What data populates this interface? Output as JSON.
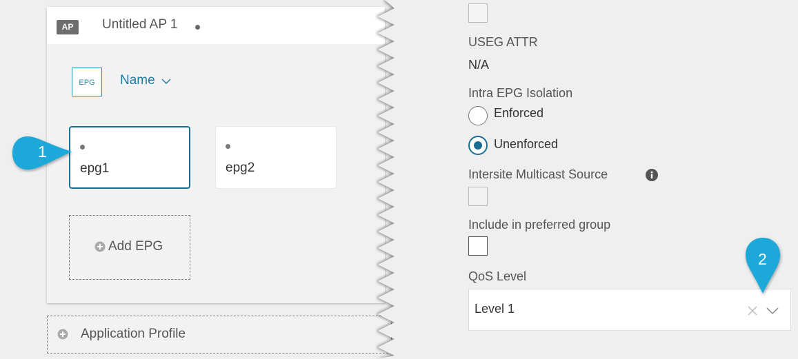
{
  "left_panel": {
    "ap": {
      "badge": "AP",
      "title": "Untitled AP 1"
    },
    "epg_header": {
      "icon_label": "EPG",
      "sort_label": "Name"
    },
    "epgs": [
      {
        "label": "epg1",
        "selected": true
      },
      {
        "label": "epg2",
        "selected": false
      }
    ],
    "add_epg_label": "Add EPG",
    "add_app_profile_label": "Application Profile"
  },
  "right_panel": {
    "useg_attr": {
      "label": "USEG ATTR",
      "value": "N/A"
    },
    "intra_epg_isolation": {
      "label": "Intra EPG Isolation",
      "options": [
        "Enforced",
        "Unenforced"
      ],
      "selected": "Unenforced"
    },
    "intersite_multicast_source": {
      "label": "Intersite Multicast Source",
      "checked": false
    },
    "include_preferred_group": {
      "label": "Include in preferred group",
      "checked": false
    },
    "qos_level": {
      "label": "QoS Level",
      "value": "Level 1"
    }
  },
  "callouts": [
    "1",
    "2"
  ],
  "colors": {
    "accent": "#1a6e91",
    "link": "#1f7aa3",
    "callout": "#1aa8d8"
  }
}
